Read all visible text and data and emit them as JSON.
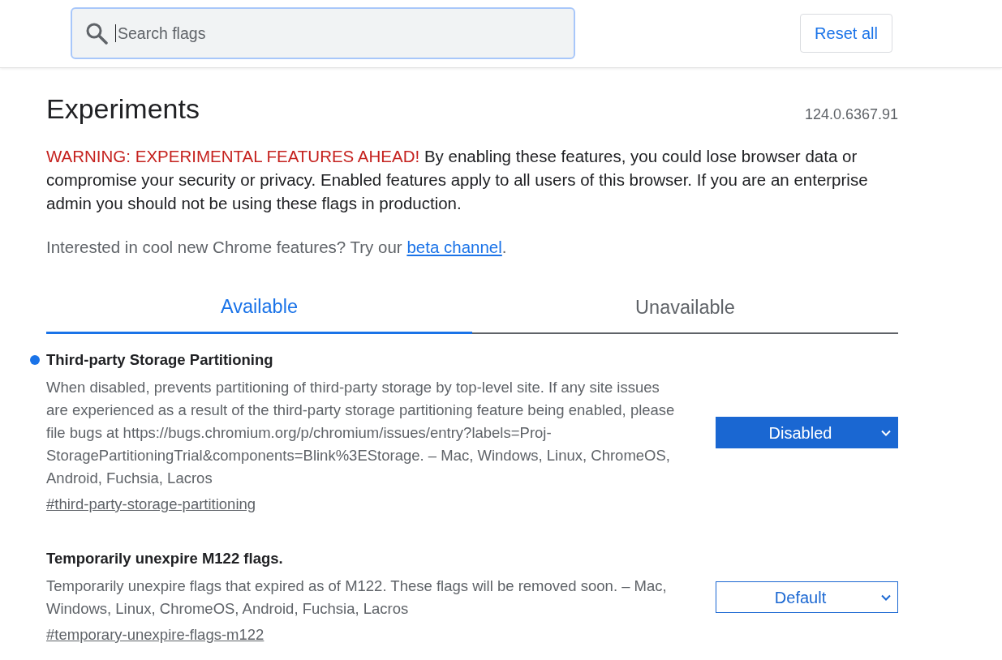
{
  "search": {
    "placeholder": "Search flags",
    "focused": true
  },
  "reset_button": "Reset all",
  "title": "Experiments",
  "version": "124.0.6367.91",
  "warning": {
    "alert": "WARNING: EXPERIMENTAL FEATURES AHEAD!",
    "text": "By enabling these features, you could lose browser data or compromise your security or privacy. Enabled features apply to all users of this browser. If you are an enterprise admin you should not be using these flags in production."
  },
  "promo": {
    "text": "Interested in cool new Chrome features? Try our",
    "link": "beta channel",
    "end": "."
  },
  "tabs": [
    {
      "label": "Available",
      "selected": true
    },
    {
      "label": "Unavailable",
      "selected": false
    }
  ],
  "flags": [
    {
      "title": "Third-party Storage Partitioning",
      "description": "When disabled, prevents partitioning of third-party storage by top-level site. If any site issues are experienced as a result of the third-party storage partitioning feature being enabled, please file bugs at https://bugs.chromium.org/p/chromium/issues/entry?labels=Proj-StoragePartitioningTrial&components=Blink%3EStorage. – Mac, Windows, Linux, ChromeOS, Android, Fuchsia, Lacros",
      "anchor": "#third-party-storage-partitioning",
      "modified": true,
      "value": "Disabled"
    },
    {
      "title": "Temporarily unexpire M122 flags.",
      "description": "Temporarily unexpire flags that expired as of M122. These flags will be removed soon. – Mac, Windows, Linux, ChromeOS, Android, Fuchsia, Lacros",
      "anchor": "#temporary-unexpire-flags-m122",
      "modified": false,
      "value": "Default"
    }
  ]
}
